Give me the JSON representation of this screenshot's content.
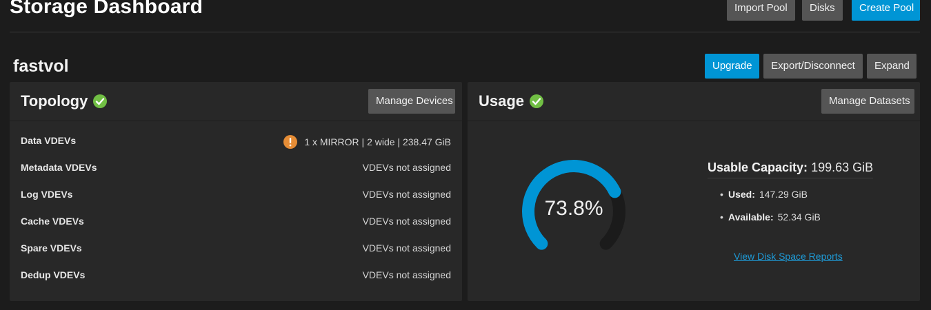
{
  "header": {
    "title": "Storage Dashboard",
    "import_pool": "Import Pool",
    "disks": "Disks",
    "create_pool": "Create Pool"
  },
  "pool": {
    "name": "fastvol",
    "upgrade": "Upgrade",
    "export_disconnect": "Export/Disconnect",
    "expand": "Expand"
  },
  "topology": {
    "title": "Topology",
    "manage_devices": "Manage Devices",
    "rows": [
      {
        "label": "Data VDEVs",
        "value": "1 x MIRROR | 2 wide | 238.47 GiB"
      },
      {
        "label": "Metadata VDEVs",
        "value": "VDEVs not assigned"
      },
      {
        "label": "Log VDEVs",
        "value": "VDEVs not assigned"
      },
      {
        "label": "Cache VDEVs",
        "value": "VDEVs not assigned"
      },
      {
        "label": "Spare VDEVs",
        "value": "VDEVs not assigned"
      },
      {
        "label": "Dedup VDEVs",
        "value": "VDEVs not assigned"
      }
    ]
  },
  "usage": {
    "title": "Usage",
    "manage_datasets": "Manage Datasets",
    "percent_label": "73.8%",
    "percent": 73.8,
    "capacity_label": "Usable Capacity:",
    "capacity_value": "199.63 GiB",
    "used_label": "Used:",
    "used_value": "147.29 GiB",
    "available_label": "Available:",
    "available_value": "52.34 GiB",
    "report_link": "View Disk Space Reports"
  },
  "colors": {
    "accent": "#0095d5",
    "ok": "#71bf44",
    "warn": "#e68d36",
    "gauge_track": "#1b1b1b"
  }
}
